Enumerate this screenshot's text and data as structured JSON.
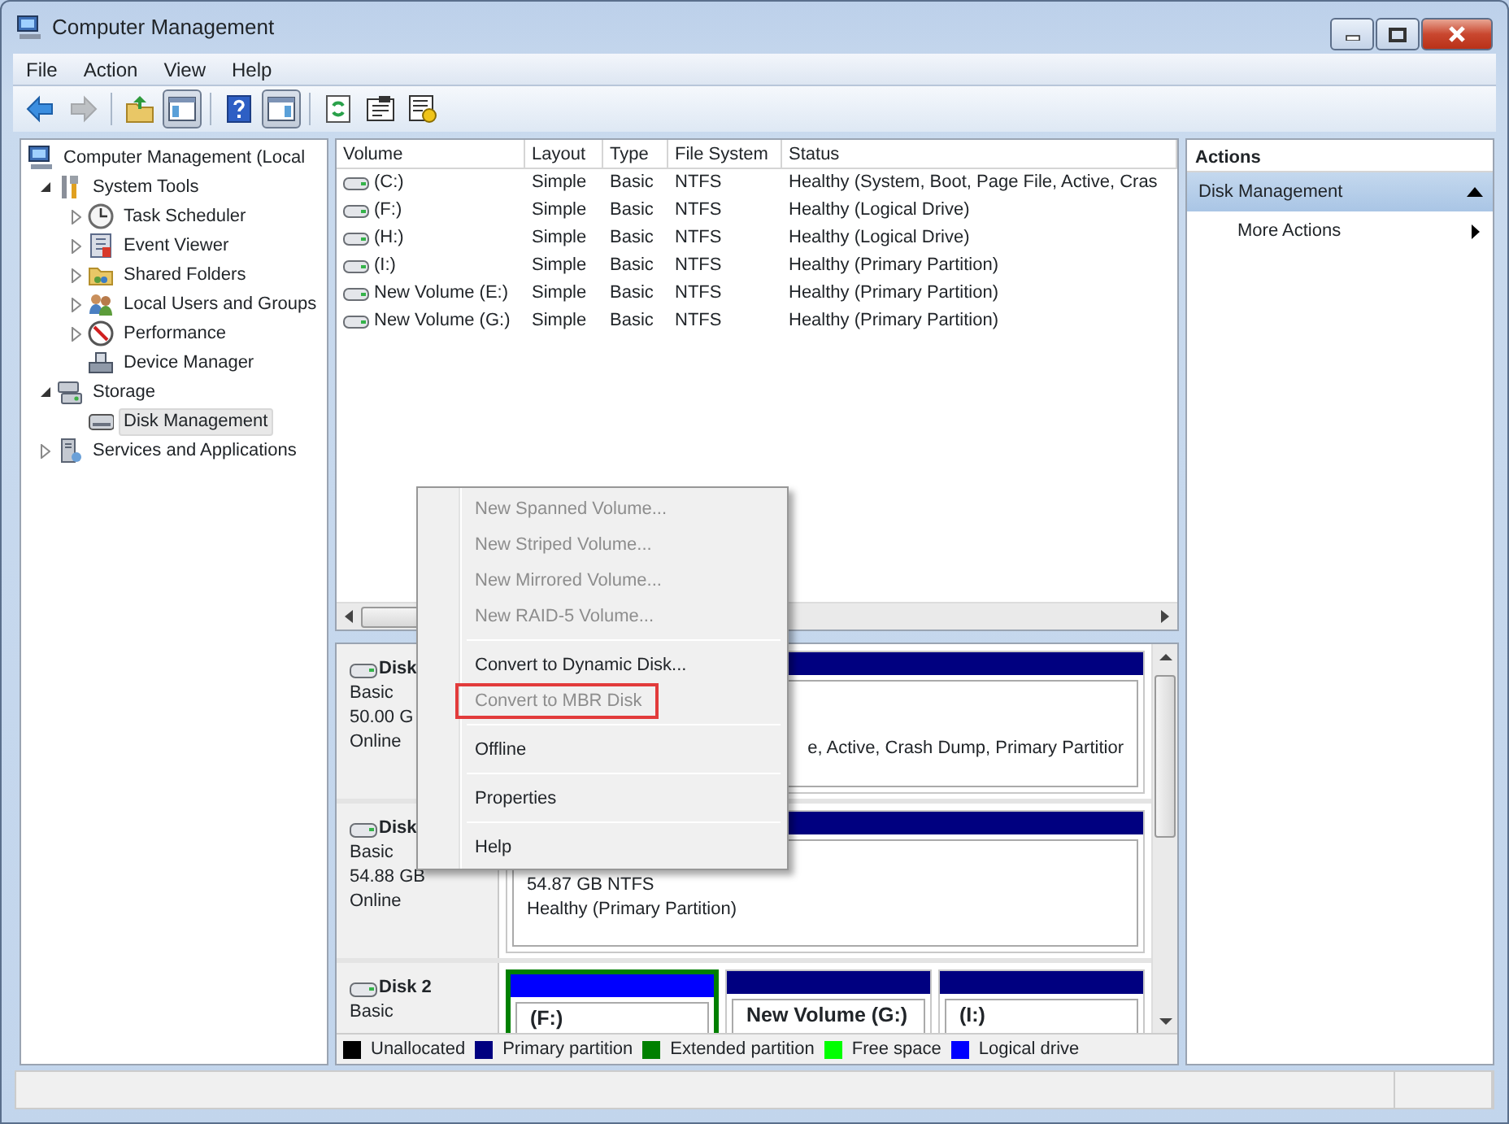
{
  "window": {
    "title": "Computer Management"
  },
  "menu_bar": [
    "File",
    "Action",
    "View",
    "Help"
  ],
  "toolbar": [
    {
      "disabled": false,
      "pressed": false
    },
    {
      "disabled": true,
      "pressed": false
    },
    {
      "disabled": false,
      "pressed": false
    },
    {
      "disabled": false,
      "pressed": true
    },
    {
      "disabled": false,
      "pressed": false
    },
    {
      "disabled": false,
      "pressed": true
    },
    {
      "disabled": false,
      "pressed": false
    },
    {
      "disabled": false,
      "pressed": false
    },
    {
      "disabled": false,
      "pressed": false
    }
  ],
  "tree": [
    {
      "label": "Computer Management (Local",
      "selected": false,
      "children": [
        {
          "label": "System Tools",
          "expanded": true,
          "selected": false,
          "children": [
            {
              "label": "Task Scheduler",
              "expanded": false,
              "selected": false
            },
            {
              "label": "Event Viewer",
              "expanded": false,
              "selected": false
            },
            {
              "label": "Shared Folders",
              "expanded": false,
              "selected": false
            },
            {
              "label": "Local Users and Groups",
              "expanded": false,
              "selected": false
            },
            {
              "label": "Performance",
              "expanded": false,
              "selected": false
            },
            {
              "label": "Device Manager",
              "selected": false
            }
          ]
        },
        {
          "label": "Storage",
          "expanded": true,
          "selected": false,
          "children": [
            {
              "label": "Disk Management",
              "selected": true
            }
          ]
        },
        {
          "label": "Services and Applications",
          "expanded": false,
          "selected": false
        }
      ]
    }
  ],
  "table": {
    "columns": [
      "Volume",
      "Layout",
      "Type",
      "File System",
      "Status"
    ],
    "rows": [
      {
        "cells": [
          "(C:)",
          "Simple",
          "Basic",
          "NTFS",
          "Healthy (System, Boot, Page File, Active, Cras"
        ]
      },
      {
        "cells": [
          "(F:)",
          "Simple",
          "Basic",
          "NTFS",
          "Healthy (Logical Drive)"
        ]
      },
      {
        "cells": [
          "(H:)",
          "Simple",
          "Basic",
          "NTFS",
          "Healthy (Logical Drive)"
        ]
      },
      {
        "cells": [
          "(I:)",
          "Simple",
          "Basic",
          "NTFS",
          "Healthy (Primary Partition)"
        ]
      },
      {
        "cells": [
          "New Volume (E:)",
          "Simple",
          "Basic",
          "NTFS",
          "Healthy (Primary Partition)"
        ]
      },
      {
        "cells": [
          "New Volume (G:)",
          "Simple",
          "Basic",
          "NTFS",
          "Healthy (Primary Partition)"
        ]
      }
    ]
  },
  "disks": [
    {
      "label": "Disk",
      "type": "Basic",
      "size": "50.00 G",
      "status": "Online",
      "partitions": [
        {
          "kind": "primary",
          "lines": [
            "e, Active, Crash Dump, Primary Partitior"
          ]
        }
      ]
    },
    {
      "label": "Disk",
      "type": "Basic",
      "size": "54.88 GB",
      "status": "Online",
      "partitions": [
        {
          "kind": "primary",
          "lines": [
            "54.87 GB NTFS",
            "Healthy (Primary Partition)"
          ]
        }
      ]
    },
    {
      "label": "Disk 2",
      "type": "Basic",
      "partitions": [
        {
          "kind": "logical",
          "name": "(F:)"
        },
        {
          "kind": "primary",
          "name": "New Volume  (G:)"
        },
        {
          "kind": "primary",
          "name": "(I:)"
        }
      ]
    }
  ],
  "legend": [
    {
      "label": "Unallocated",
      "color": "#000000"
    },
    {
      "label": "Primary partition",
      "color": "#000080"
    },
    {
      "label": "Extended partition",
      "color": "#008000"
    },
    {
      "label": "Free space",
      "color": "#00ff00"
    },
    {
      "label": "Logical drive",
      "color": "#0000ff"
    }
  ],
  "actions": {
    "title": "Actions",
    "groups": [
      {
        "label": "Disk Management",
        "expanded": true,
        "items": [
          {
            "label": "More Actions"
          }
        ]
      }
    ]
  },
  "context_menu": [
    [
      {
        "label": "New Spanned Volume...",
        "disabled": true,
        "highlighted": false
      },
      {
        "label": "New Striped Volume...",
        "disabled": true,
        "highlighted": false
      },
      {
        "label": "New Mirrored Volume...",
        "disabled": true,
        "highlighted": false
      },
      {
        "label": "New RAID-5 Volume...",
        "disabled": true,
        "highlighted": false
      }
    ],
    [
      {
        "label": "Convert to Dynamic Disk...",
        "disabled": false,
        "highlighted": false
      },
      {
        "label": "Convert to MBR Disk",
        "disabled": true,
        "highlighted": true
      }
    ],
    [
      {
        "label": "Offline",
        "disabled": false,
        "highlighted": false
      }
    ],
    [
      {
        "label": "Properties",
        "disabled": false,
        "highlighted": false
      }
    ],
    [
      {
        "label": "Help",
        "disabled": false,
        "highlighted": false
      }
    ]
  ]
}
